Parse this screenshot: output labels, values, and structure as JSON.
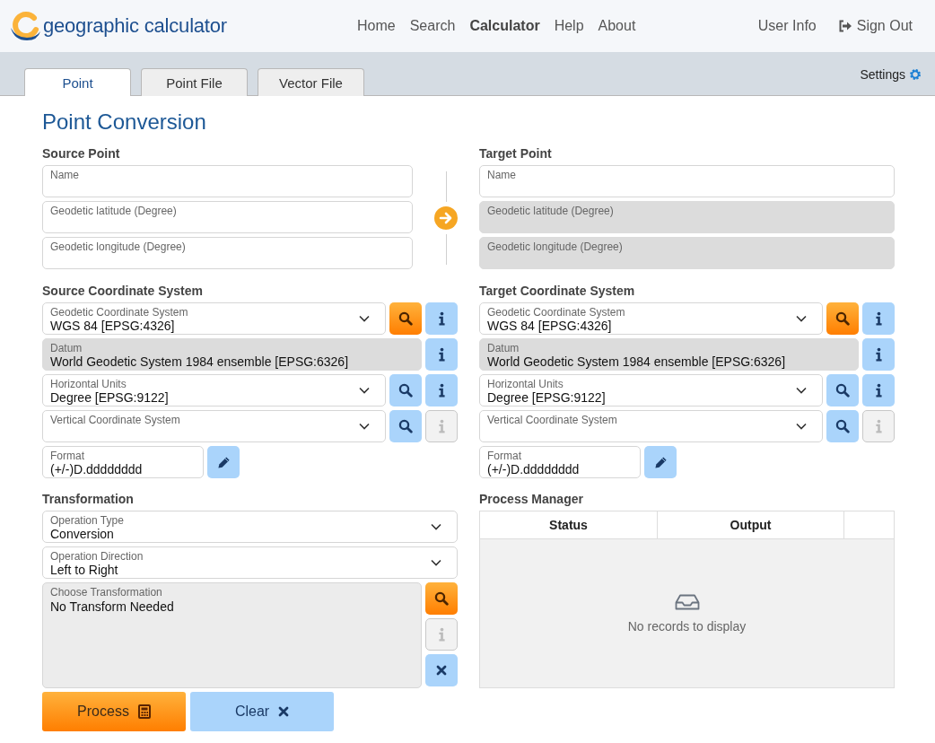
{
  "header": {
    "app_name": "geographic calculator",
    "nav": [
      {
        "label": "Home",
        "selected": false
      },
      {
        "label": "Search",
        "selected": false
      },
      {
        "label": "Calculator",
        "selected": true
      },
      {
        "label": "Help",
        "selected": false
      },
      {
        "label": "About",
        "selected": false
      }
    ],
    "user_links": [
      {
        "label": "User Info",
        "kind": "plain"
      },
      {
        "label": "Sign Out",
        "kind": "signout"
      }
    ]
  },
  "tabs": [
    {
      "label": "Point",
      "selected": true
    },
    {
      "label": "Point File",
      "selected": false
    },
    {
      "label": "Vector File",
      "selected": false
    }
  ],
  "settings": {
    "label": "Settings"
  },
  "page_title": "Point Conversion",
  "source_point": {
    "title": "Source Point",
    "fields": [
      {
        "label": "Name",
        "disabled": false
      },
      {
        "label": "Geodetic latitude (Degree)",
        "disabled": false
      },
      {
        "label": "Geodetic longitude (Degree)",
        "disabled": false
      }
    ]
  },
  "target_point": {
    "title": "Target Point",
    "fields": [
      {
        "label": "Name",
        "disabled": false
      },
      {
        "label": "Geodetic latitude (Degree)",
        "disabled": true
      },
      {
        "label": "Geodetic longitude (Degree)",
        "disabled": true
      }
    ]
  },
  "source_crs": {
    "title": "Source Coordinate System",
    "rows": [
      {
        "kind": "select",
        "label": "Geodetic Coordinate System",
        "value": "WGS 84 [EPSG:4326]",
        "search_highlighted": true,
        "info_disabled": false
      },
      {
        "kind": "readonly",
        "label": "Datum",
        "value": "World Geodetic System 1984 ensemble [EPSG:6326]",
        "info_disabled": false
      },
      {
        "kind": "select",
        "label": "Horizontal Units",
        "value": "Degree [EPSG:9122]",
        "search_highlighted": false,
        "info_disabled": false
      },
      {
        "kind": "select",
        "label": "Vertical Coordinate System",
        "search_highlighted": false,
        "info_disabled": true
      }
    ],
    "format": {
      "label": "Format",
      "value": "(+/-)D.dddddddd"
    }
  },
  "target_crs": {
    "title": "Target Coordinate System",
    "rows": [
      {
        "kind": "select",
        "label": "Geodetic Coordinate System",
        "value": "WGS 84 [EPSG:4326]",
        "search_highlighted": true,
        "info_disabled": false
      },
      {
        "kind": "readonly",
        "label": "Datum",
        "value": "World Geodetic System 1984 ensemble [EPSG:6326]",
        "info_disabled": false
      },
      {
        "kind": "select",
        "label": "Horizontal Units",
        "value": "Degree [EPSG:9122]",
        "search_highlighted": false,
        "info_disabled": false
      },
      {
        "kind": "select",
        "label": "Vertical Coordinate System",
        "search_highlighted": false,
        "info_disabled": true
      }
    ],
    "format": {
      "label": "Format",
      "value": "(+/-)D.dddddddd"
    }
  },
  "transformation": {
    "title": "Transformation",
    "selects": [
      {
        "label": "Operation Type",
        "value": "Conversion"
      },
      {
        "label": "Operation Direction",
        "value": "Left to Right"
      }
    ],
    "choose": {
      "label": "Choose Transformation",
      "value": "No Transform Needed",
      "search_highlighted": true,
      "info_disabled": true
    }
  },
  "actions": [
    {
      "label": "Process",
      "kind": "process"
    },
    {
      "label": "Clear",
      "kind": "clear"
    }
  ],
  "process_manager": {
    "title": "Process Manager",
    "columns": [
      "Status",
      "Output"
    ],
    "empty_message": "No records to display"
  }
}
